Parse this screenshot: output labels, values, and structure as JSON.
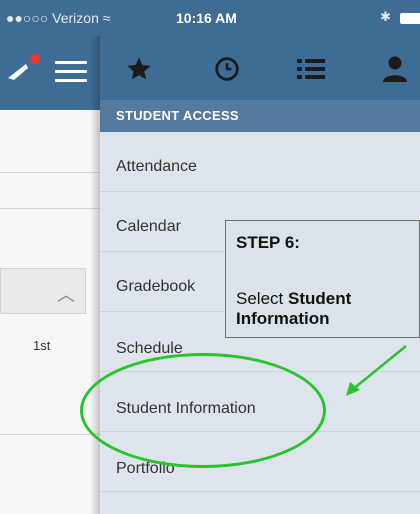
{
  "status_bar": {
    "carrier": "Verizon",
    "time": "10:16 AM"
  },
  "left_panel": {
    "column_label": "1st"
  },
  "menu": {
    "tabs": [
      {
        "icon": "star-icon"
      },
      {
        "icon": "clock-icon"
      },
      {
        "icon": "list-icon"
      },
      {
        "icon": "person-icon"
      }
    ],
    "section_header": "STUDENT ACCESS",
    "items": [
      {
        "label": "Attendance"
      },
      {
        "label": "Calendar"
      },
      {
        "label": "Gradebook"
      },
      {
        "label": "Schedule"
      },
      {
        "label": "Student Information"
      },
      {
        "label": "Portfolio"
      }
    ]
  },
  "callout": {
    "title": "STEP 6:",
    "text_prefix": "Select",
    "text_bold_1": "Student",
    "text_bold_2": "Information"
  },
  "colors": {
    "header_blue": "#3f6c95",
    "annotation_green": "#27c42b"
  }
}
